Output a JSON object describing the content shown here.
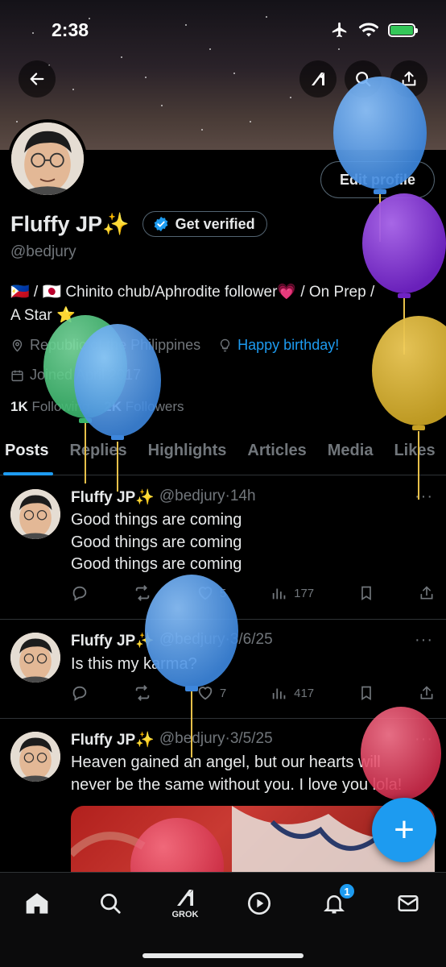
{
  "status_bar": {
    "time": "2:38"
  },
  "profile": {
    "display_name": "Fluffy JP",
    "sparkle": "✨",
    "get_verified_label": "Get verified",
    "handle": "@bedjury",
    "bio_line1": "🇵🇭 / 🇯🇵 Chinito chub/Aphrodite follower💗 / On Prep /",
    "bio_line2": "A Star ⭐",
    "location": "Republic of the Philippines",
    "birthday": "Happy birthday!",
    "joined": "Joined April 2017",
    "following_count": "1K",
    "following_label": "Following",
    "followers_count": "2K",
    "followers_label": "Followers",
    "edit_profile_label": "Edit profile"
  },
  "tabs": [
    {
      "label": "Posts",
      "active": true
    },
    {
      "label": "Replies"
    },
    {
      "label": "Highlights"
    },
    {
      "label": "Articles"
    },
    {
      "label": "Media"
    },
    {
      "label": "Likes"
    }
  ],
  "posts": [
    {
      "name": "Fluffy JP✨",
      "handle": "@bedjury",
      "time": "·14h",
      "lines": [
        "Good things are coming",
        "Good things are coming",
        "Good things are coming"
      ],
      "likes": "5",
      "views": "177"
    },
    {
      "name": "Fluffy JP✨",
      "handle": "@bedjury",
      "time": "·3/6/25",
      "lines": [
        "Is this my karma?"
      ],
      "likes": "7",
      "views": "417"
    },
    {
      "name": "Fluffy JP✨",
      "handle": "@bedjury",
      "time": "·3/5/25",
      "lines": [
        "Heaven gained an angel, but our hearts will",
        "never be the same without you. I love you lola!"
      ]
    }
  ],
  "more_glyph": "···",
  "fab_glyph": "+",
  "bottom_nav": {
    "grok_label": "GROK",
    "notif_badge": "1"
  },
  "icons": [
    "back-arrow-icon",
    "grok-icon",
    "search-icon",
    "share-icon",
    "verified-check-icon",
    "location-pin-icon",
    "lightbulb-icon",
    "calendar-icon",
    "reply-icon",
    "repost-icon",
    "heart-icon",
    "views-icon",
    "bookmark-icon",
    "home-icon",
    "play-icon",
    "bell-icon",
    "mail-icon"
  ],
  "colors": {
    "accent": "#1d9bf0",
    "muted": "#71767b",
    "text": "#e7e9ea",
    "border": "#2f3336"
  }
}
